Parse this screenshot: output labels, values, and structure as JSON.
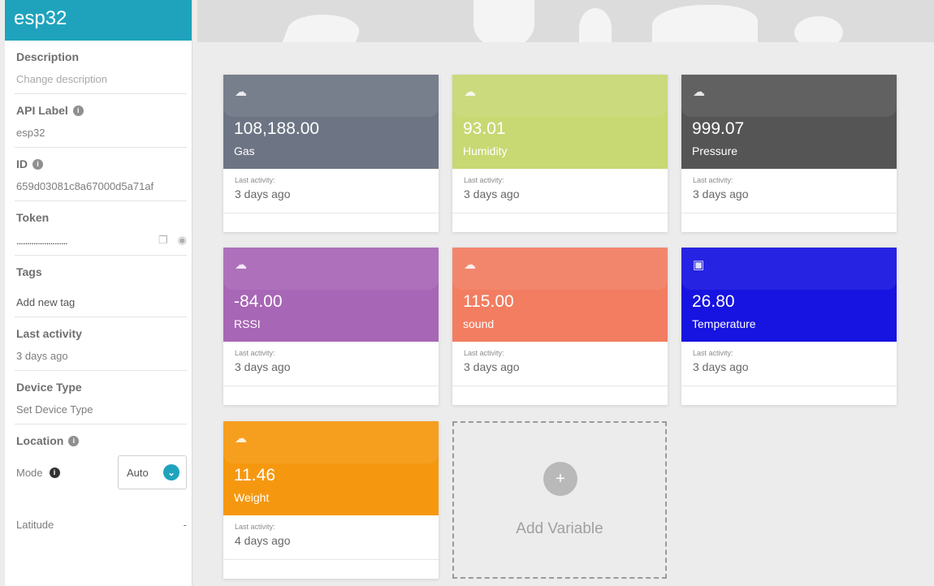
{
  "device": {
    "name": "esp32"
  },
  "sidebar": {
    "description": {
      "label": "Description",
      "placeholder": "Change description"
    },
    "api_label": {
      "label": "API Label",
      "value": "esp32"
    },
    "id": {
      "label": "ID",
      "value": "659d03081c8a67000d5a71af"
    },
    "token": {
      "label": "Token",
      "masked": "........................"
    },
    "tags": {
      "label": "Tags",
      "placeholder": "Add new tag"
    },
    "last_activity": {
      "label": "Last activity",
      "value": "3 days ago"
    },
    "device_type": {
      "label": "Device Type",
      "placeholder": "Set Device Type"
    },
    "location": {
      "label": "Location",
      "mode_label": "Mode",
      "mode_value": "Auto",
      "latitude_label": "Latitude",
      "latitude_value": "-"
    }
  },
  "variables": [
    {
      "value": "108,188.00",
      "name": "Gas",
      "last_label": "Last activity:",
      "last_value": "3 days ago",
      "color": "#6d7584",
      "icon": "cloud-upload-icon"
    },
    {
      "value": "93.01",
      "name": "Humidity",
      "last_label": "Last activity:",
      "last_value": "3 days ago",
      "color": "#c8d873",
      "icon": "cloud-upload-icon"
    },
    {
      "value": "999.07",
      "name": "Pressure",
      "last_label": "Last activity:",
      "last_value": "3 days ago",
      "color": "#555555",
      "icon": "cloud-upload-icon"
    },
    {
      "value": "-84.00",
      "name": "RSSI",
      "last_label": "Last activity:",
      "last_value": "3 days ago",
      "color": "#a866b6",
      "icon": "cloud-upload-icon"
    },
    {
      "value": "115.00",
      "name": "sound",
      "last_label": "Last activity:",
      "last_value": "3 days ago",
      "color": "#f27d61",
      "icon": "cloud-upload-icon"
    },
    {
      "value": "26.80",
      "name": "Temperature",
      "last_label": "Last activity:",
      "last_value": "3 days ago",
      "color": "#1713e0",
      "icon": "area-chart-icon"
    },
    {
      "value": "11.46",
      "name": "Weight",
      "last_label": "Last activity:",
      "last_value": "4 days ago",
      "color": "#f6980f",
      "icon": "cloud-upload-icon"
    }
  ],
  "add_variable": {
    "label": "Add Variable",
    "symbol": "+"
  }
}
